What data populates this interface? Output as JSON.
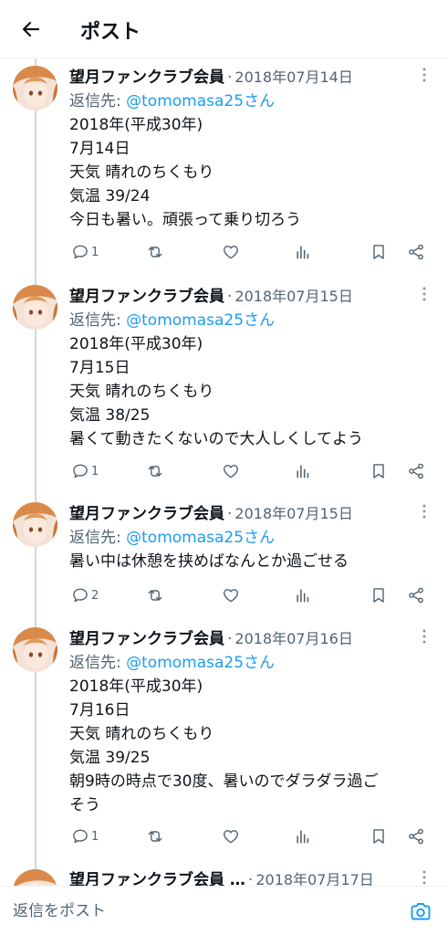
{
  "header": {
    "title": "ポスト",
    "back_icon": "arrow-left-icon"
  },
  "tweets": [
    {
      "name": "望月ファンクラブ会員",
      "separator": "·",
      "date": "2018年07月14日",
      "reply_prefix": "返信先: ",
      "reply_handle": "@tomomasa25さん",
      "lines": [
        "2018年(平成30年)",
        "7月14日",
        "天気 晴れのちくもり",
        "気温 39/24",
        "今日も暑い。頑張って乗り切ろう"
      ],
      "reply_count": "1"
    },
    {
      "name": "望月ファンクラブ会員",
      "separator": "·",
      "date": "2018年07月15日",
      "reply_prefix": "返信先: ",
      "reply_handle": "@tomomasa25さん",
      "lines": [
        "2018年(平成30年)",
        "7月15日",
        "天気 晴れのちくもり",
        "気温 38/25",
        "暑くて動きたくないので大人しくしてよう"
      ],
      "reply_count": "1"
    },
    {
      "name": "望月ファンクラブ会員",
      "separator": "·",
      "date": "2018年07月15日",
      "reply_prefix": "返信先: ",
      "reply_handle": "@tomomasa25さん",
      "lines": [
        "暑い中は休憩を挟めばなんとか過ごせる"
      ],
      "reply_count": "2"
    },
    {
      "name": "望月ファンクラブ会員",
      "separator": "·",
      "date": "2018年07月16日",
      "reply_prefix": "返信先: ",
      "reply_handle": "@tomomasa25さん",
      "lines": [
        "2018年(平成30年)",
        "7月16日",
        "天気 晴れのちくもり",
        "気温 39/25",
        "朝9時の時点で30度、暑いのでダラダラ過ご",
        "そう"
      ],
      "reply_count": "1"
    },
    {
      "name": "望月ファンクラブ会員 …",
      "separator": "·",
      "date": "2018年07月17日"
    }
  ],
  "composer": {
    "placeholder": "返信をポスト",
    "camera_icon": "camera-icon"
  },
  "colors": {
    "accent": "#1d9bf0",
    "muted": "#536471",
    "text": "#0f1419",
    "divider": "#eff3f4"
  }
}
